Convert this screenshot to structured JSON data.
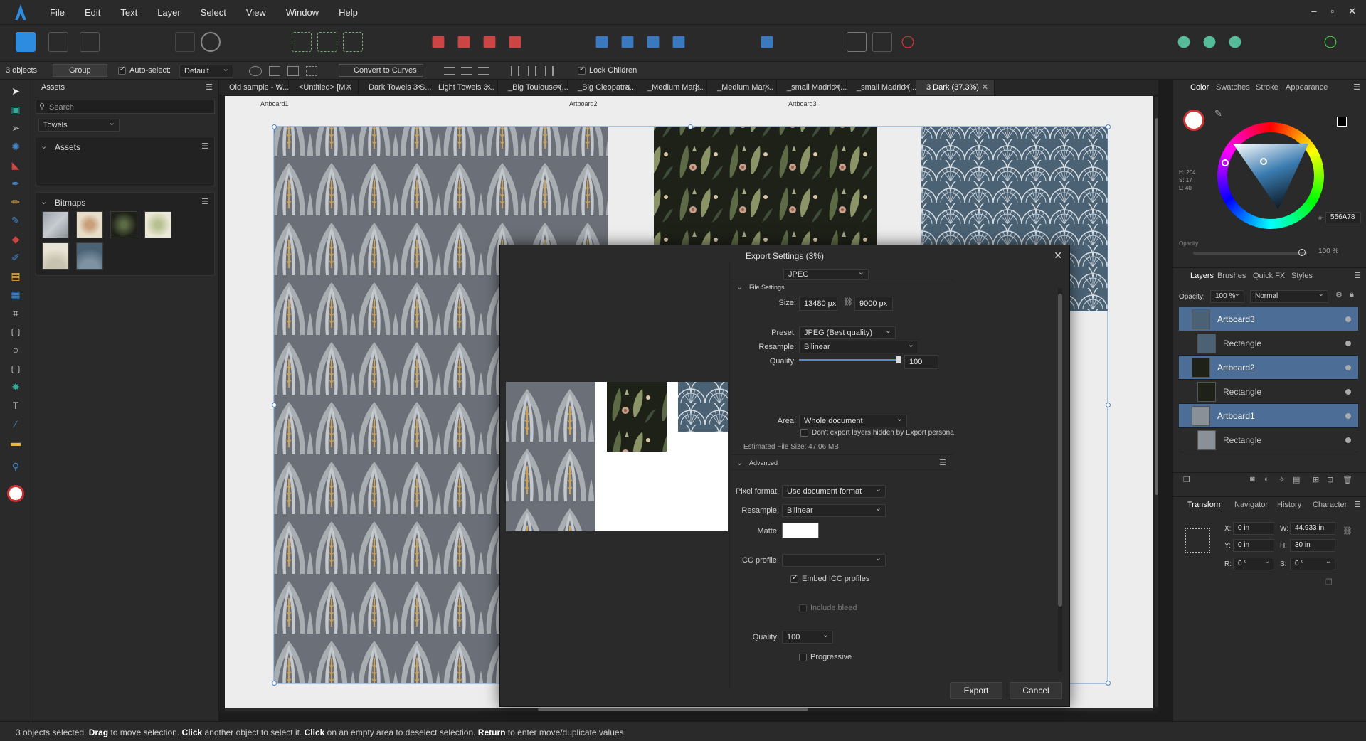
{
  "menu": [
    "File",
    "Edit",
    "Text",
    "Layer",
    "Select",
    "View",
    "Window",
    "Help"
  ],
  "window_controls": [
    "–",
    "▫",
    "✕"
  ],
  "context": {
    "selection": "3 objects",
    "group": "Group",
    "auto_select_label": "Auto-select:",
    "auto_select_value": "Default",
    "convert_curves": "Convert to Curves",
    "lock_children": "Lock Children"
  },
  "assets_panel": {
    "tab": "Assets",
    "search_placeholder": "Search",
    "category": "Towels",
    "section_assets": "Assets",
    "section_bitmaps": "Bitmaps"
  },
  "doc_tabs": [
    "Old sample - W...",
    "<Untitled> [M...",
    "Dark Towels 3 S...",
    "Light Towels 3...",
    "_Big Toulouse (...",
    "_Big Cleopatra...",
    "_Medium Marj...",
    "_Medium Marj...",
    "_small Madrid (...",
    "_small Madrid (...",
    "3 Dark (37.3%)"
  ],
  "artboards": {
    "a1": "Artboard1",
    "a2": "Artboard2",
    "a3": "Artboard3"
  },
  "export": {
    "title": "Export Settings (3%)",
    "format": "JPEG",
    "file_settings": "File Settings",
    "size_label": "Size:",
    "width": "13480 px",
    "height": "9000 px",
    "preset_label": "Preset:",
    "preset": "JPEG (Best quality)",
    "resample_label": "Resample:",
    "resample": "Bilinear",
    "quality_label": "Quality:",
    "quality": "100",
    "quality_fraction": 1.0,
    "area_label": "Area:",
    "area": "Whole document",
    "dont_export": "Don't export layers hidden by Export persona",
    "estimated": "Estimated File Size: 47.06 MB",
    "advanced": "Advanced",
    "pixel_format_label": "Pixel format:",
    "pixel_format": "Use document format",
    "resample2_label": "Resample:",
    "resample2": "Bilinear",
    "matte_label": "Matte:",
    "icc_label": "ICC profile:",
    "embed_icc": "Embed ICC profiles",
    "include_bleed": "Include bleed",
    "quality2_label": "Quality:",
    "quality2": "100",
    "progressive": "Progressive",
    "export_btn": "Export",
    "cancel_btn": "Cancel"
  },
  "color_panel": {
    "tabs": [
      "Color",
      "Swatches",
      "Stroke",
      "Appearance"
    ],
    "h": "H: 204",
    "s": "S: 17",
    "l": "L: 40",
    "hex": "556A78",
    "opacity_label": "Opacity",
    "opacity_value": "100 %"
  },
  "layers_panel": {
    "tabs": [
      "Layers",
      "Brushes",
      "Quick FX",
      "Styles"
    ],
    "opacity_label": "Opacity:",
    "opacity_value": "100 %",
    "blend": "Normal",
    "items": [
      "Artboard3",
      "Rectangle",
      "Artboard2",
      "Rectangle",
      "Artboard1",
      "Rectangle"
    ]
  },
  "transform_panel": {
    "tabs": [
      "Transform",
      "Navigator",
      "History",
      "Character"
    ],
    "x_label": "X:",
    "x": "0 in",
    "y_label": "Y:",
    "y": "0 in",
    "w_label": "W:",
    "w": "44.933 in",
    "h_label": "H:",
    "h": "30 in",
    "r_label": "R:",
    "r": "0 °",
    "s_label": "S:",
    "s": "0 °"
  },
  "status": {
    "count": "3 objects selected.",
    "b1": "Drag",
    "t1": "to move selection.",
    "b2": "Click",
    "t2": "another object to select it.",
    "b3": "Click",
    "t3": "on an empty area to deselect selection.",
    "b4": "Return",
    "t4": "to enter move/duplicate values."
  },
  "colors": {
    "accent": "#2d8be0",
    "selected_layer": "#4c6e96",
    "towel_gray": "#6b7078",
    "towel_navy": "#4b6275",
    "towel_dark": "#1e2118"
  }
}
